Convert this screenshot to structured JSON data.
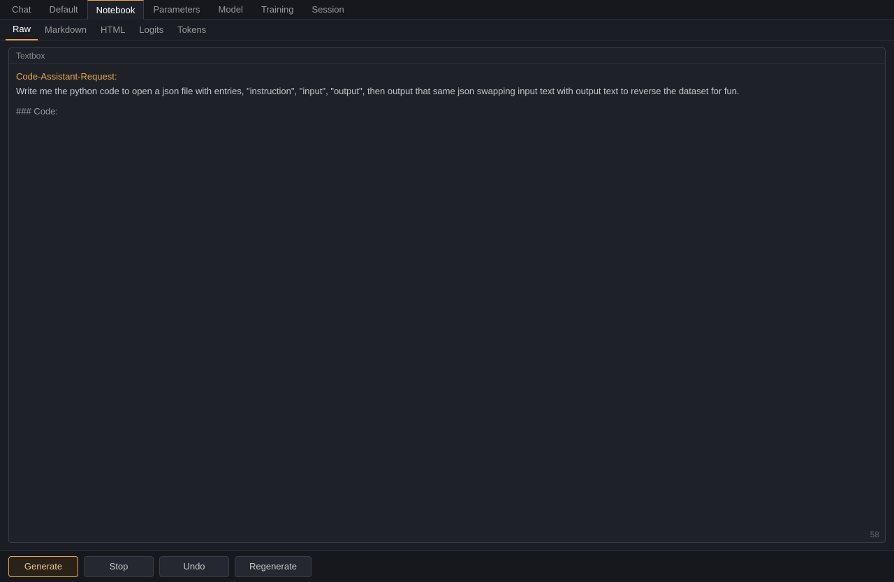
{
  "nav": {
    "tabs": [
      {
        "label": "Chat",
        "id": "chat",
        "active": false
      },
      {
        "label": "Default",
        "id": "default",
        "active": false
      },
      {
        "label": "Notebook",
        "id": "notebook",
        "active": true
      },
      {
        "label": "Parameters",
        "id": "parameters",
        "active": false
      },
      {
        "label": "Model",
        "id": "model",
        "active": false
      },
      {
        "label": "Training",
        "id": "training",
        "active": false
      },
      {
        "label": "Session",
        "id": "session",
        "active": false
      }
    ]
  },
  "sub_tabs": {
    "tabs": [
      {
        "label": "Raw",
        "id": "raw",
        "active": true
      },
      {
        "label": "Markdown",
        "id": "markdown",
        "active": false
      },
      {
        "label": "HTML",
        "id": "html",
        "active": false
      },
      {
        "label": "Logits",
        "id": "logits",
        "active": false
      },
      {
        "label": "Tokens",
        "id": "tokens",
        "active": false
      }
    ]
  },
  "textbox": {
    "label": "Textbox",
    "line1": "Code-Assistant-Request:",
    "line2": "Write me the python code to open a json file with entries, \"instruction\", \"input\", \"output\", then output that same json swapping input text with output text to reverse the dataset for fun.",
    "line3": "### Code:",
    "token_count": "58"
  },
  "toolbar": {
    "generate_label": "Generate",
    "stop_label": "Stop",
    "undo_label": "Undo",
    "regenerate_label": "Regenerate"
  }
}
